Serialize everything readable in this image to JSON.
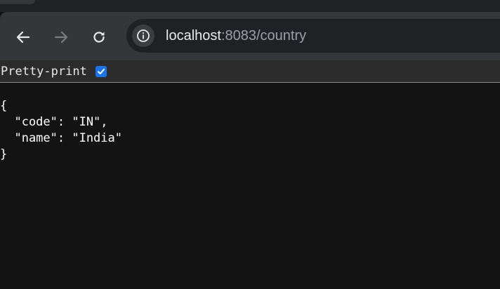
{
  "toolbar": {
    "back_icon": "arrow-left-icon",
    "forward_icon": "arrow-right-icon",
    "reload_icon": "reload-icon",
    "site_info_icon": "info-icon"
  },
  "address_bar": {
    "host": "localhost",
    "rest": ":8083/country"
  },
  "pretty_print": {
    "label": "Pretty-print",
    "checked": true
  },
  "json": {
    "open_brace": "{",
    "lines": [
      "  \"code\": \"IN\",",
      "  \"name\": \"India\""
    ],
    "close_brace": "}"
  },
  "colors": {
    "toolbar_bg": "#35363a",
    "omnibox_bg": "#202124",
    "page_bg": "#131313",
    "checkbox_accent": "#1a73e8"
  }
}
